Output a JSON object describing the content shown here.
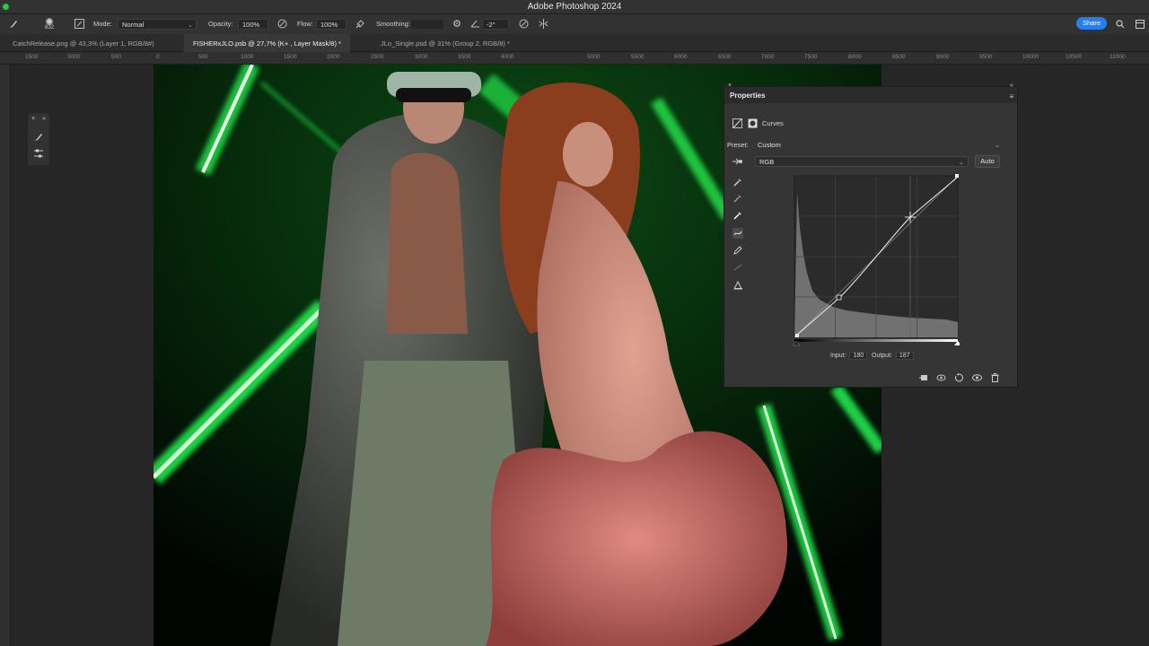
{
  "app": {
    "title": "Adobe Photoshop 2024"
  },
  "options": {
    "mode_label": "Mode:",
    "mode_value": "Normal",
    "opacity_label": "Opacity:",
    "opacity_value": "100%",
    "flow_label": "Flow:",
    "flow_value": "100%",
    "smoothing_label": "Smoothing:",
    "angle_value": "-2°",
    "brush_size": "832",
    "share_label": "Share"
  },
  "tabs": [
    {
      "label": "CatchRelease.png @ 43,3% (Layer 1, RGB/8#)"
    },
    {
      "label": "FISHERxJLO.psb @ 27,7% (K+ , Layer Mask/8) *"
    },
    {
      "label": "JLo_Single.psd @ 31% (Group 2, RGB/8) *"
    }
  ],
  "ruler": [
    "1500",
    "3000",
    "500",
    "0",
    "500",
    "1000",
    "1500",
    "2000",
    "2500",
    "3000",
    "3500",
    "4000",
    "5000",
    "5500",
    "6000",
    "6500",
    "7000",
    "7500",
    "8000",
    "8500",
    "9000",
    "9500",
    "10000",
    "10500",
    "11000"
  ],
  "properties": {
    "title": "Properties",
    "adjustment": "Curves",
    "preset_label": "Preset:",
    "preset_value": "Custom",
    "channel_value": "RGB",
    "auto_label": "Auto",
    "input_label": "Input:",
    "input_value": "180",
    "output_label": "Output:",
    "output_value": "187"
  },
  "icons": {
    "brush": "brush-icon",
    "search": "search-icon",
    "gear": "gear-icon"
  },
  "colors": {
    "accent": "#2680eb",
    "laser": "#23ff4a",
    "panel": "#353535"
  }
}
